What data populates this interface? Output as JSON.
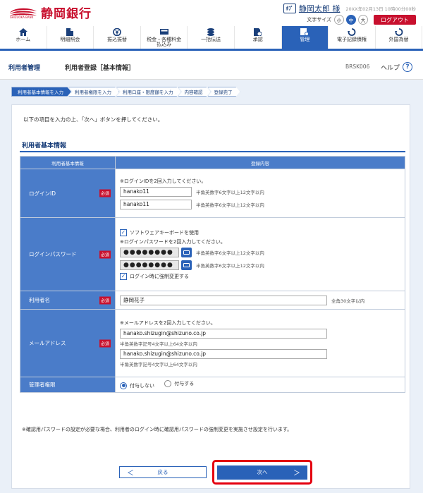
{
  "header": {
    "bank_name": "静岡銀行",
    "bank_name_en": "SHIZUOKA BANK",
    "user_icon_label": "ﾎﾌﾟ",
    "user_name": "静岡太郎 様",
    "login_time": "20XX年02月13日 10時00分00秒",
    "font_size_label": "文字サイズ",
    "font_sizes": [
      "小",
      "中",
      "大"
    ],
    "logout_label": "ログアウト"
  },
  "nav": {
    "items": [
      {
        "label": "ホーム",
        "icon": "home-icon"
      },
      {
        "label": "明細照会",
        "icon": "document-icon"
      },
      {
        "label": "振込振替",
        "icon": "transfer-icon"
      },
      {
        "label": "税金・各種料金\n払込み",
        "icon": "payment-icon"
      },
      {
        "label": "一括伝送",
        "icon": "coins-icon"
      },
      {
        "label": "承認",
        "icon": "approval-icon"
      },
      {
        "label": "管理",
        "icon": "management-icon"
      },
      {
        "label": "電子記録債権",
        "icon": "e-bond-icon"
      },
      {
        "label": "外国為替",
        "icon": "forex-icon"
      }
    ]
  },
  "title": {
    "crumb1": "利用者管理",
    "crumb2": "利用者登録［基本情報］",
    "screen_id": "BRSK006",
    "help_label": "ヘルプ",
    "help_icon": "?"
  },
  "steps": [
    "利用者基本情報を入力",
    "利用者権限を入力",
    "利用口座・限度額を入力",
    "内容確認",
    "登録完了"
  ],
  "intro": "以下の項目を入力の上、「次へ」ボタンを押してください。",
  "section_title": "利用者基本情報",
  "table": {
    "head_left": "利用者基本情報",
    "head_right": "登録内容",
    "required": "必須",
    "login_id": {
      "label": "ログインID",
      "note": "※ログインIDを2回入力してください。",
      "value1": "hanako11",
      "value2": "hanako11",
      "hint": "半角英数字6文字以上12文字以内"
    },
    "password": {
      "label": "ログインパスワード",
      "software_kbd": "ソフトウェアキーボードを使用",
      "note": "※ログインパスワードを2回入力してください。",
      "value1": "●●●●●●●●",
      "value2": "●●●●●●●●",
      "hint": "半角英数字6文字以上12文字以内",
      "force_change": "ログイン時に強制変更する"
    },
    "user_name": {
      "label": "利用者名",
      "value": "静岡花子",
      "hint": "全角30文字以内"
    },
    "email": {
      "label": "メールアドレス",
      "note": "※メールアドレスを2回入力してください。",
      "value1": "hanako.shizugin@shizuno.co.jp",
      "value2": "hanako.shizugin@shizuno.co.jp",
      "hint": "半角英数字記号4文字以上64文字以内"
    },
    "admin": {
      "label": "管理者権限",
      "opt_no": "付与しない",
      "opt_yes": "付与する"
    }
  },
  "footnote": "※確認用パスワードの設定が必要な場合、利用者のログイン時に確認用パスワードの強制変更を実施させ設定を行います。",
  "buttons": {
    "back": "戻る",
    "next": "次へ",
    "back_arrow": "＜",
    "next_arrow": "＞"
  },
  "colors": {
    "brand": "#c8102e",
    "accent": "#2a62b8",
    "highlight": "#e4000f"
  }
}
